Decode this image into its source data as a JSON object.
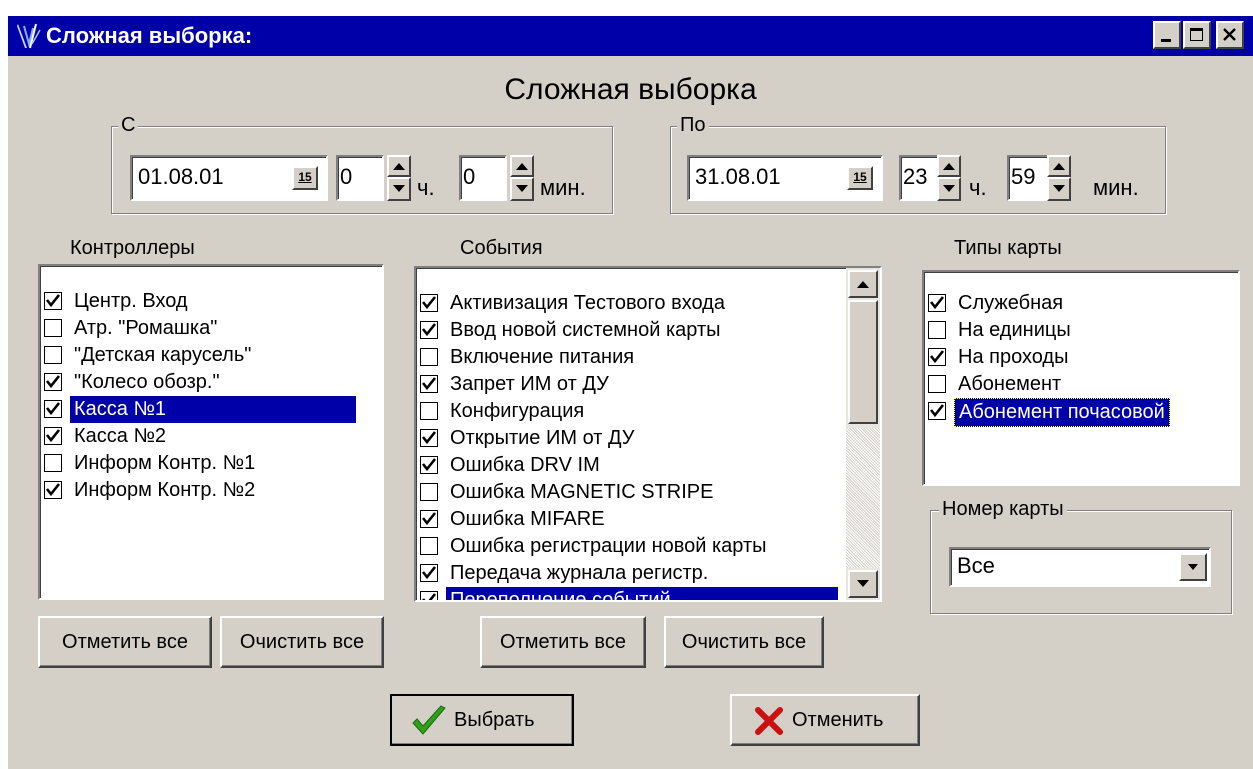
{
  "window": {
    "title": "Сложная выборка:",
    "heading": "Сложная выборка"
  },
  "from": {
    "legend": "С",
    "date": "01.08.01",
    "calendar_label": "15",
    "hours": "0",
    "hours_unit": "ч.",
    "minutes": "0",
    "minutes_unit": "мин."
  },
  "to": {
    "legend": "По",
    "date": "31.08.01",
    "calendar_label": "15",
    "hours": "23",
    "hours_unit": "ч.",
    "minutes": "59",
    "minutes_unit": "мин."
  },
  "controllers": {
    "label": "Контроллеры",
    "items": [
      {
        "label": "Центр. Вход",
        "checked": true,
        "selected": false
      },
      {
        "label": "Атр. \"Ромашка\"",
        "checked": false,
        "selected": false
      },
      {
        "label": "\"Детская карусель\"",
        "checked": false,
        "selected": false
      },
      {
        "label": "\"Колесо обозр.\"",
        "checked": true,
        "selected": false
      },
      {
        "label": "Касса №1",
        "checked": true,
        "selected": true
      },
      {
        "label": "Касса №2",
        "checked": true,
        "selected": false
      },
      {
        "label": "Информ Контр. №1",
        "checked": false,
        "selected": false
      },
      {
        "label": "Информ Контр. №2",
        "checked": true,
        "selected": false
      }
    ],
    "check_all_label": "Отметить все",
    "clear_all_label": "Очистить все"
  },
  "events": {
    "label": "События",
    "items": [
      {
        "label": "Активизация Тестового входа",
        "checked": true,
        "selected": false
      },
      {
        "label": "Ввод новой системной карты",
        "checked": true,
        "selected": false
      },
      {
        "label": "Включение питания",
        "checked": false,
        "selected": false
      },
      {
        "label": "Запрет ИМ от ДУ",
        "checked": true,
        "selected": false
      },
      {
        "label": "Конфигурация",
        "checked": false,
        "selected": false
      },
      {
        "label": "Открытие ИМ от ДУ",
        "checked": true,
        "selected": false
      },
      {
        "label": "Ошибка DRV IM",
        "checked": true,
        "selected": false
      },
      {
        "label": "Ошибка MAGNETIC STRIPE",
        "checked": false,
        "selected": false
      },
      {
        "label": "Ошибка MIFARE",
        "checked": true,
        "selected": false
      },
      {
        "label": "Ошибка регистрации новой карты",
        "checked": false,
        "selected": false
      },
      {
        "label": "Передача журнала регистр.",
        "checked": true,
        "selected": false
      },
      {
        "label": "Переполнение событий",
        "checked": true,
        "selected": true
      }
    ],
    "check_all_label": "Отметить все",
    "clear_all_label": "Очистить все"
  },
  "card_types": {
    "label": "Типы карты",
    "items": [
      {
        "label": "Служебная",
        "checked": true,
        "selected": false
      },
      {
        "label": "На единицы",
        "checked": false,
        "selected": false
      },
      {
        "label": "На проходы",
        "checked": true,
        "selected": false
      },
      {
        "label": "Абонемент",
        "checked": false,
        "selected": false
      },
      {
        "label": "Абонемент почасовой",
        "checked": true,
        "selected": true
      }
    ]
  },
  "card_number": {
    "legend": "Номер карты",
    "value": "Все"
  },
  "actions": {
    "select_label": "Выбрать",
    "cancel_label": "Отменить"
  },
  "colors": {
    "title_bar": "#0000a8",
    "window_bg": "#d4d0c8",
    "selection": "#0000a8",
    "ok_icon": "#2ea01a",
    "cancel_icon": "#cc1010"
  }
}
